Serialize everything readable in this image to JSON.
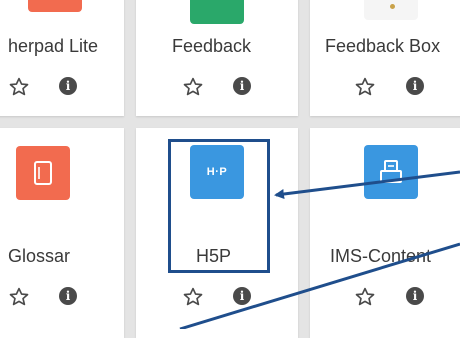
{
  "colors": {
    "etherpad": "#f26b4f",
    "feedback": "#2aa86a",
    "glossary": "#f26b4f",
    "h5p": "#3a97e0",
    "ims": "#3a97e0",
    "annotation": "#1f4e8c"
  },
  "tiles": [
    {
      "label": "herpad Lite",
      "icon": "etherpad-icon"
    },
    {
      "label": "Feedback",
      "icon": "feedback-icon"
    },
    {
      "label": "Feedback Box",
      "icon": "feedback-box-icon"
    },
    {
      "label": "Glossar",
      "icon": "glossary-icon"
    },
    {
      "label": "H5P",
      "icon": "h5p-icon",
      "icon_text": "H·P"
    },
    {
      "label": "IMS-Content",
      "icon": "ims-content-icon"
    }
  ],
  "actions": {
    "star": "star-icon",
    "info": "info-icon",
    "info_glyph": "i"
  }
}
